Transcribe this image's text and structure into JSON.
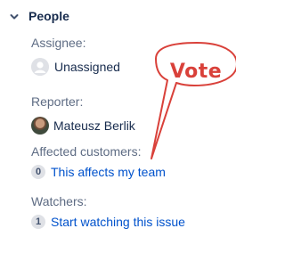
{
  "section": {
    "title": "People",
    "chevron_icon": "chevron-down-icon"
  },
  "assignee": {
    "label": "Assignee:",
    "value": "Unassigned",
    "avatar_icon": "user-placeholder-icon"
  },
  "reporter": {
    "label": "Reporter:",
    "value": "Mateusz Berlik"
  },
  "affected_customers": {
    "label": "Affected customers:",
    "count": "0",
    "link_text": "This affects my team"
  },
  "watchers": {
    "label": "Watchers:",
    "count": "1",
    "link_text": "Start watching this issue"
  },
  "annotation": {
    "text": "Vote",
    "color": "#d9413a"
  },
  "colors": {
    "link": "#0052cc",
    "label": "#5e6c84",
    "text": "#172b4d",
    "badge_bg": "#dfe1e6"
  }
}
